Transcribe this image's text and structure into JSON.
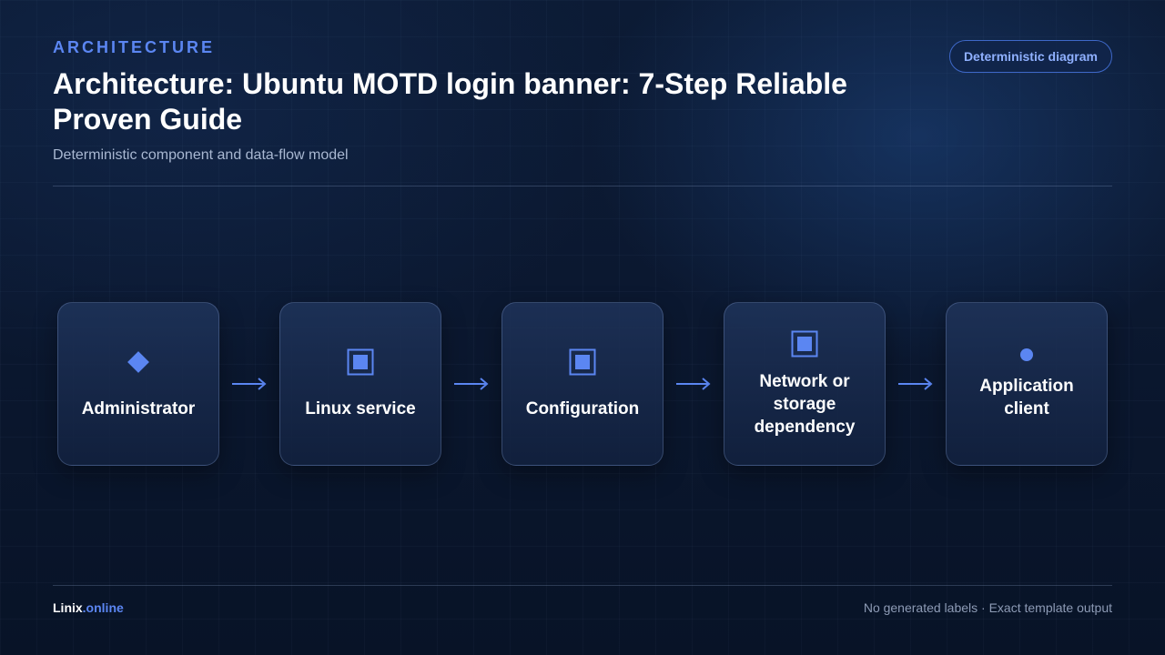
{
  "header": {
    "eyebrow": "ARCHITECTURE",
    "title": "Architecture: Ubuntu MOTD login banner: 7-Step Reliable Proven Guide",
    "subtitle": "Deterministic component and data-flow model",
    "badge": "Deterministic diagram"
  },
  "diagram": {
    "nodes": [
      {
        "label": "Administrator",
        "icon": "diamond-icon"
      },
      {
        "label": "Linux service",
        "icon": "square-icon"
      },
      {
        "label": "Configuration",
        "icon": "square-icon"
      },
      {
        "label": "Network or storage dependency",
        "icon": "square-icon"
      },
      {
        "label": "Application client",
        "icon": "dot-icon"
      }
    ],
    "connector": "right-arrow-icon"
  },
  "footer": {
    "brand_name": "Linix",
    "brand_tld": ".online",
    "note": "No generated labels · Exact template output"
  },
  "colors": {
    "accent": "#5b86f2",
    "background": "#0b1830",
    "node_fill": "#1c2f55",
    "node_border": "#3d5488"
  }
}
